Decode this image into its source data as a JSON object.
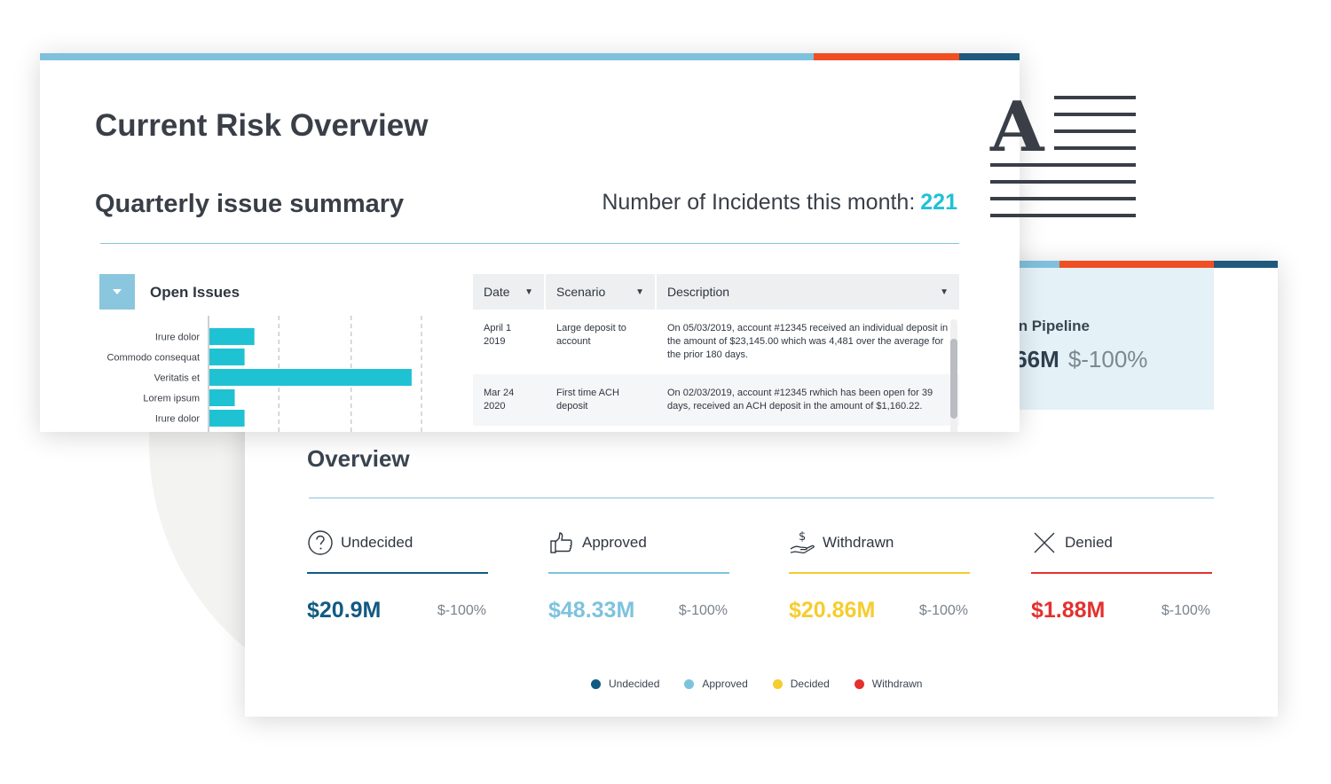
{
  "colors": {
    "stripe_light": "#7fc0dc",
    "stripe_orange": "#f04e23",
    "stripe_navy": "#1f5a7e",
    "accent_teal": "#1fc2d3",
    "undecided": "#125a82",
    "approved": "#7dc3de",
    "withdrawn": "#f5cd2f",
    "denied": "#e3312f"
  },
  "risk_overview": {
    "title": "Current Risk Overview",
    "section_title": "Quarterly issue summary",
    "incidents_label": "Number of Incidents this month:",
    "incidents_count": "221"
  },
  "open_issues": {
    "title": "Open Issues",
    "toggle_icon": "chevron-down-icon"
  },
  "chart_data": {
    "type": "bar",
    "orientation": "horizontal",
    "categories": [
      "Irure dolor",
      "Commodo consequat",
      "Veritatis et",
      "Lorem ipsum",
      "Irure dolor"
    ],
    "values": [
      14,
      11,
      62,
      8,
      11
    ],
    "xlim": [
      0,
      65
    ],
    "grid": true
  },
  "issues_table": {
    "columns": [
      "Date",
      "Scenario",
      "Description"
    ],
    "rows": [
      {
        "date": "April 1 2019",
        "scenario": "Large deposit to account",
        "description": "On 05/03/2019, account #12345 received an individual deposit in the amount of $23,145.00 which was 4,481 over the average for the prior 180 days."
      },
      {
        "date": "Mar 24 2020",
        "scenario": "First time ACH deposit",
        "description": "On 02/03/2019, account #12345 rwhich has been open for 39 days, received an ACH deposit in the amount of $1,160.22."
      }
    ]
  },
  "pipeline": {
    "label": "t in Pipeline",
    "value": ".66M",
    "change": "$-100%"
  },
  "overview": {
    "title": "Overview",
    "stats": [
      {
        "label": "Undecided",
        "value": "$20.9M",
        "change": "$-100%",
        "icon": "question-circle-icon"
      },
      {
        "label": "Approved",
        "value": "$48.33M",
        "change": "$-100%",
        "icon": "thumbs-up-icon"
      },
      {
        "label": "Withdrawn",
        "value": "$20.86M",
        "change": "$-100%",
        "icon": "dollar-hand-icon"
      },
      {
        "label": "Denied",
        "value": "$1.88M",
        "change": "$-100%",
        "icon": "x-mark-icon"
      }
    ],
    "legend": [
      "Undecided",
      "Approved",
      "Decided",
      "Withdrawn"
    ]
  },
  "document_icon": "document-text-icon"
}
